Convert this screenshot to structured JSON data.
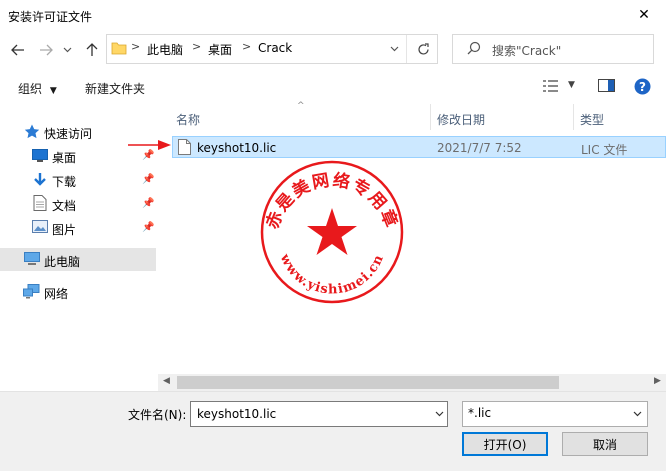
{
  "window": {
    "title": "安装许可证文件",
    "close_glyph": "✕"
  },
  "nav": {
    "breadcrumbs": [
      "此电脑",
      "桌面",
      "Crack"
    ],
    "search_placeholder": "搜索\"Crack\""
  },
  "toolbar": {
    "organize": "组织",
    "new_folder": "新建文件夹"
  },
  "sidebar": {
    "items": [
      {
        "label": "快速访问",
        "icon": "star-icon"
      },
      {
        "label": "桌面",
        "icon": "desktop-icon",
        "pinned": true
      },
      {
        "label": "下载",
        "icon": "download-icon",
        "pinned": true
      },
      {
        "label": "文档",
        "icon": "document-icon",
        "pinned": true
      },
      {
        "label": "图片",
        "icon": "picture-icon",
        "pinned": true
      },
      {
        "label": "此电脑",
        "icon": "computer-icon",
        "selected": true
      },
      {
        "label": "网络",
        "icon": "network-icon"
      }
    ]
  },
  "filelist": {
    "columns": [
      "名称",
      "修改日期",
      "类型"
    ],
    "rows": [
      {
        "name": "keyshot10.lic",
        "modified": "2021/7/7 7:52",
        "type": "LIC 文件",
        "selected": true
      }
    ]
  },
  "watermark": {
    "text_top": "赤是美网络专用章",
    "text_bottom": "www.yishimei.cn",
    "color": "#e8191c"
  },
  "bottom": {
    "filename_label": "文件名(N):",
    "filename_value": "keyshot10.lic",
    "filter_value": "*.lic",
    "open_label": "打开(O)",
    "cancel_label": "取消"
  },
  "colors": {
    "selection_bg": "#cce8ff",
    "accent": "#0078d7",
    "arrow_red": "#e8191c"
  }
}
